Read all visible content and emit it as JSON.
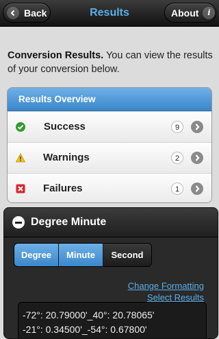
{
  "header": {
    "back_label": "Back",
    "title": "Results",
    "about_label": "About",
    "back_icon": "chevron-left-icon",
    "about_icon": "info-icon"
  },
  "intro": {
    "bold": "Conversion Results.",
    "text": " You can view the results of your conversion below."
  },
  "results": {
    "header": "Results Overview",
    "rows": [
      {
        "label": "Success",
        "count": "9",
        "icon": "check-icon",
        "color": "#2e9e2e"
      },
      {
        "label": "Warnings",
        "count": "2",
        "icon": "warning-icon",
        "color": "#f0c419"
      },
      {
        "label": "Failures",
        "count": "1",
        "icon": "error-icon",
        "color": "#d9262b"
      }
    ]
  },
  "collapsible": {
    "title": "Degree Minute",
    "tabs": [
      {
        "label": "Degree",
        "active": true
      },
      {
        "label": "Minute",
        "active": true
      },
      {
        "label": "Second",
        "active": false
      }
    ],
    "links": {
      "change_formatting": "Change Formatting",
      "select_results": "Select Results"
    },
    "output_lines": [
      "-72°: 20.79000'_40°: 20.78065'",
      "-21°: 0.34500'_-54°: 0.67800'"
    ]
  },
  "colors": {
    "accent": "#5aaee8",
    "active_blue": "#3a87cc"
  }
}
